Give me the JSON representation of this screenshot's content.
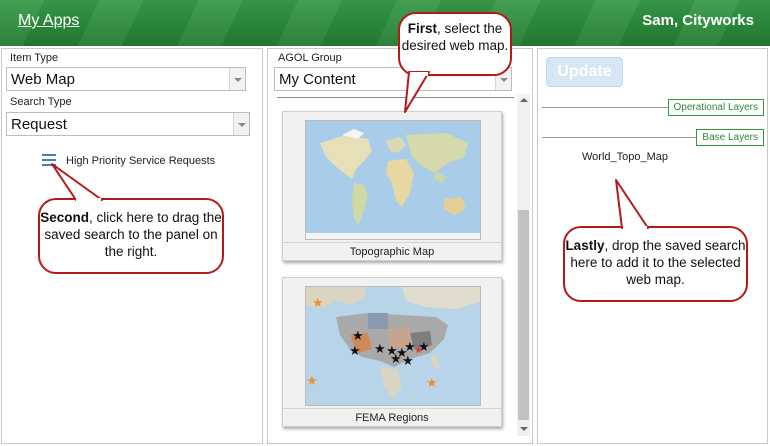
{
  "header": {
    "app_title": "My Apps",
    "user": "Sam, Cityworks",
    "accent_color": "#2a8a3a"
  },
  "left_panel": {
    "item_type_label": "Item Type",
    "item_type_value": "Web Map",
    "search_type_label": "Search Type",
    "search_type_value": "Request",
    "saved_search": {
      "icon": "hamburger-icon",
      "label": "High Priority Service Requests"
    }
  },
  "middle_panel": {
    "group_label": "AGOL Group",
    "group_value": "My Content",
    "maps": [
      {
        "caption": "Topographic Map",
        "thumbnail": "world-topographic-map"
      },
      {
        "caption": "FEMA Regions",
        "thumbnail": "usa-fema-regions-map"
      }
    ]
  },
  "right_panel": {
    "update_label": "Update",
    "operational_layers_label": "Operational Layers",
    "base_layers_label": "Base Layers",
    "base_layer_item": "World_Topo_Map"
  },
  "callouts": {
    "first": {
      "bold": "First",
      "text": ", select the desired web map."
    },
    "second": {
      "bold": "Second",
      "text": ", click here to drag the saved search to the panel on the right."
    },
    "lastly": {
      "bold": "Lastly",
      "text": ", drop the saved search here to add it to the selected web map."
    },
    "border_color": "#b51a1a"
  }
}
